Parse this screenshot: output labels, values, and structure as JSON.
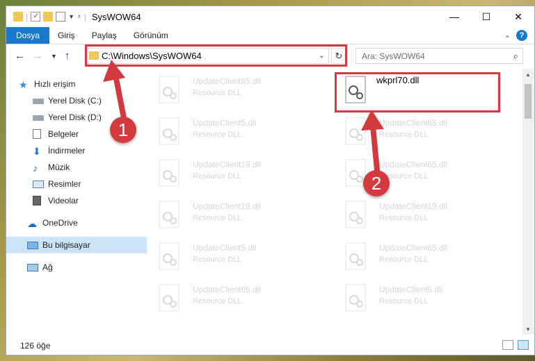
{
  "window": {
    "title": "SysWOW64",
    "controls": {
      "minimize": "—",
      "maximize": "☐",
      "close": "✕"
    }
  },
  "ribbon": {
    "tabs": [
      "Dosya",
      "Giriş",
      "Paylaş",
      "Görünüm"
    ],
    "help": "?"
  },
  "address": {
    "path": "C:\\Windows\\SysWOW64",
    "search_placeholder": "Ara: SysWOW64"
  },
  "nav": {
    "items": [
      {
        "label": "Hızlı erişim",
        "icon": "star-icon"
      },
      {
        "label": "Yerel Disk (C:)",
        "icon": "drive-icon",
        "pinned": true
      },
      {
        "label": "Yerel Disk (D:)",
        "icon": "drive-icon",
        "pinned": true
      },
      {
        "label": "Belgeler",
        "icon": "documents-icon",
        "pinned": true
      },
      {
        "label": "İndirmeler",
        "icon": "download-icon",
        "pinned": true
      },
      {
        "label": "Müzik",
        "icon": "music-icon",
        "pinned": true
      },
      {
        "label": "Resimler",
        "icon": "pictures-icon",
        "pinned": true
      },
      {
        "label": "Videolar",
        "icon": "videos-icon",
        "pinned": true
      },
      {
        "label": "OneDrive",
        "icon": "cloud-icon"
      },
      {
        "label": "Bu bilgisayar",
        "icon": "computer-icon",
        "selected": true
      },
      {
        "label": "Ağ",
        "icon": "network-icon"
      }
    ]
  },
  "files": {
    "highlighted": {
      "name": "wkprl70.dll"
    },
    "left_column": [
      {
        "name": "UpdateClient65.dll",
        "type": "Resource DLL"
      },
      {
        "name": "UpdateClient5.dll",
        "type": "Resource DLL"
      },
      {
        "name": "UpdateClient19.dll",
        "type": "Resource DLL"
      },
      {
        "name": "UpdateClient19.dll",
        "type": "Resource DLL"
      },
      {
        "name": "UpdateClient5.dll",
        "type": "Resource DLL"
      },
      {
        "name": "UpdateClient65.dll",
        "type": "Resource DLL"
      }
    ],
    "right_column": [
      {
        "name": "UpdateClient65.dll",
        "type": "Resource DLL"
      },
      {
        "name": "UpdateClient65.dll",
        "type": "Resource DLL"
      },
      {
        "name": "UpdateClient19.dll",
        "type": "Resource DLL"
      },
      {
        "name": "UpdateClient65.dll",
        "type": "Resource DLL"
      },
      {
        "name": "UpdateClient5.dll",
        "type": "Resource DLL"
      }
    ]
  },
  "status": {
    "count": "126 öğe"
  },
  "annotations": {
    "step1": "1",
    "step2": "2"
  },
  "colors": {
    "accent": "#1979ca",
    "annotation_red": "#d23a3f",
    "selection": "#cce4f7"
  }
}
